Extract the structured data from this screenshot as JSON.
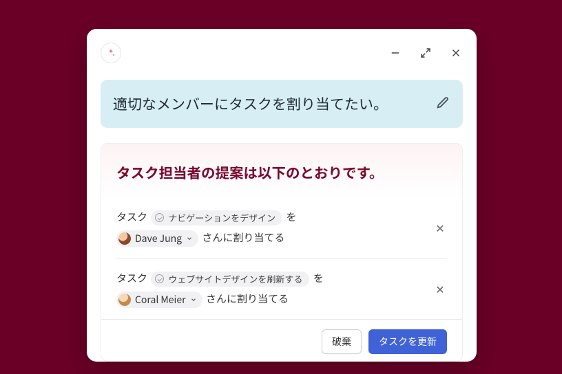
{
  "prompt": {
    "text": "適切なメンバーにタスクを割り当てたい。"
  },
  "response": {
    "title": "タスク担当者の提案は以下のとおりです。"
  },
  "labels": {
    "task_prefix": "タスク",
    "task_suffix": "を",
    "assign_suffix": "さんに割り当てる"
  },
  "suggestions": [
    {
      "task_name": "ナビゲーションをデザイン",
      "assignee": "Dave Jung"
    },
    {
      "task_name": "ウェブサイトデザインを刷新する",
      "assignee": "Coral Meier"
    }
  ],
  "actions": {
    "discard": "破棄",
    "update": "タスクを更新"
  }
}
